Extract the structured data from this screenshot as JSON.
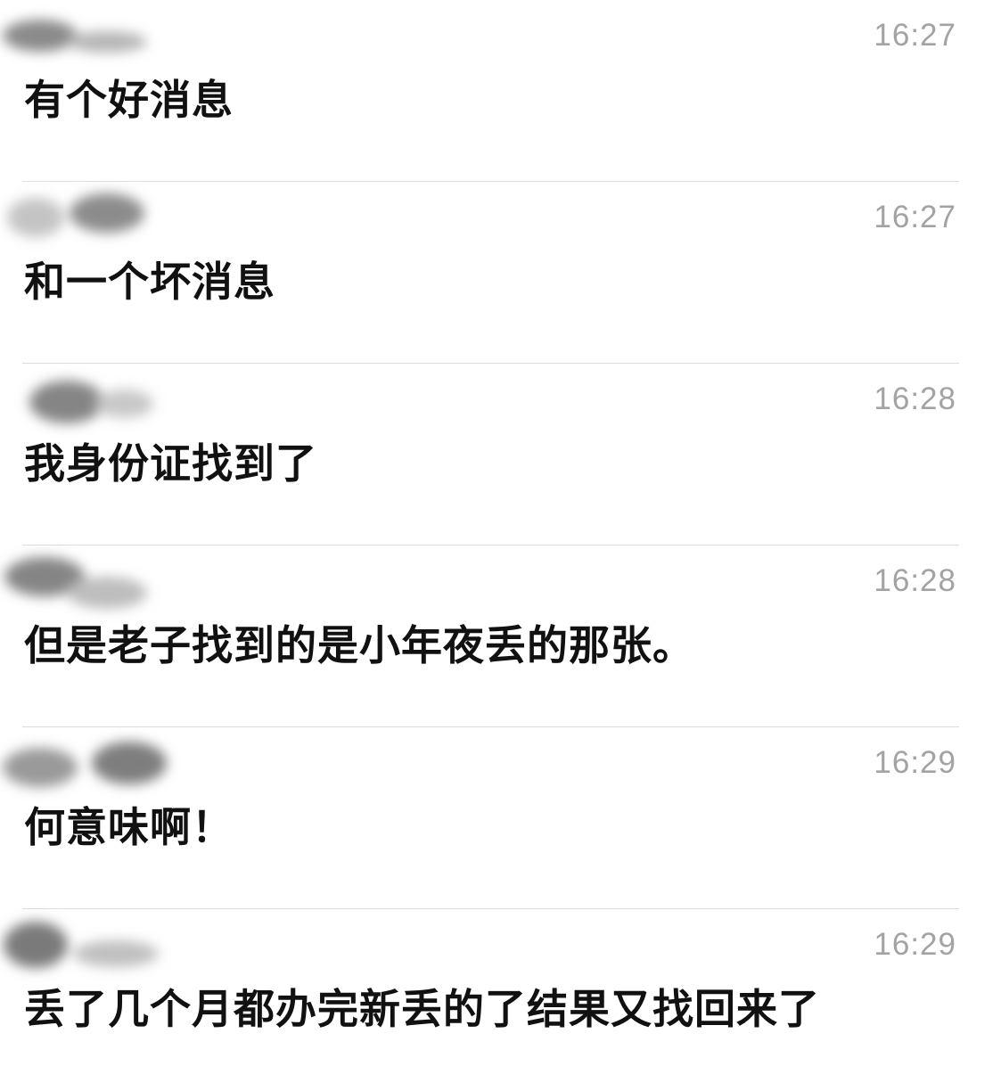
{
  "messages": [
    {
      "time": "16:27",
      "text": "有个好消息"
    },
    {
      "time": "16:27",
      "text": "和一个坏消息"
    },
    {
      "time": "16:28",
      "text": "我身份证找到了"
    },
    {
      "time": "16:28",
      "text": "但是老子找到的是小年夜丢的那张。"
    },
    {
      "time": "16:29",
      "text": "何意味啊！"
    },
    {
      "time": "16:29",
      "text": "丢了几个月都办完新丢的了结果又找回来了"
    }
  ],
  "colors": {
    "text": "#111111",
    "timestamp": "#a3a3a3",
    "divider": "#dcdcdc",
    "background": "#ffffff"
  }
}
